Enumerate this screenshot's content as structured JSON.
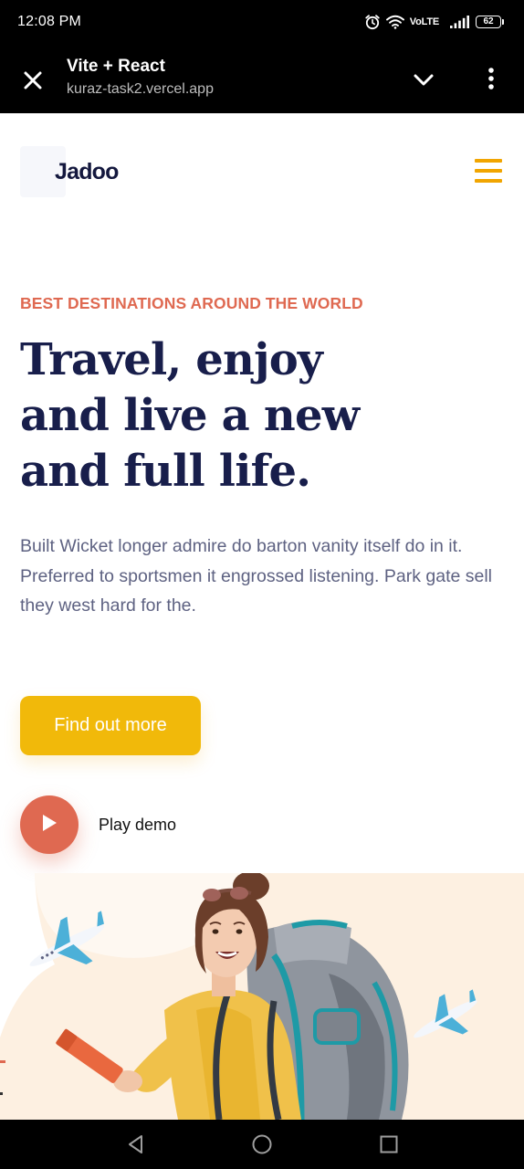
{
  "status_bar": {
    "time": "12:08 PM",
    "network_label": "VoLTE",
    "battery_level": "62"
  },
  "browser": {
    "page_title": "Vite + React",
    "url": "kuraz-task2.vercel.app",
    "icons": [
      "close-icon",
      "chevron-down-icon",
      "more-vert-icon"
    ]
  },
  "site": {
    "logo_text": "Jadoo",
    "menu_icon": "hamburger-menu-icon",
    "accent_color": "#f1a501"
  },
  "hero": {
    "eyebrow": "BEST DESTINATIONS AROUND THE WORLD",
    "headline_lines": [
      "Travel, enjoy",
      "and live a new",
      "and full life."
    ],
    "description_lines": [
      "Built Wicket longer admire do barton vanity itself do in it.",
      "Preferred to sportsmen it engrossed listening. Park gate sell they west hard for the."
    ],
    "cta_label": "Find out more",
    "play_label": "Play demo",
    "colors": {
      "eyebrow": "#df6951",
      "headline": "#181e4b",
      "body": "#5e6282",
      "cta": "#f1b90a",
      "play": "#df6951"
    }
  },
  "nav_bar": {
    "icons": [
      "back-icon",
      "home-icon",
      "recents-icon"
    ]
  }
}
